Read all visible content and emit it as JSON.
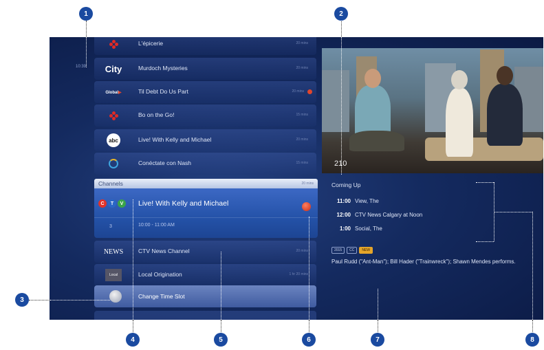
{
  "clock": "10:39",
  "guide": {
    "rows": [
      {
        "logo": "cbc",
        "title": "L'épicerie",
        "duration": "20 mins"
      },
      {
        "logo": "city",
        "logo_text": "City",
        "title": "Murdoch Mysteries",
        "duration": "20 mins"
      },
      {
        "logo": "global",
        "logo_text": "Global",
        "title": "Til Debt Do Us Part",
        "duration": "20 mins"
      },
      {
        "logo": "cbc",
        "title": "Bo on the Go!",
        "duration": "15 mins"
      },
      {
        "logo": "abc",
        "logo_text": "abc",
        "title": "Live! With Kelly and Michael",
        "duration": "20 mins"
      },
      {
        "logo": "omni",
        "title": "Conéctate con Nash",
        "duration": "15 mins"
      }
    ],
    "channels_label": "Channels",
    "channels_duration": "20 mins",
    "selected": {
      "logo_letters": [
        "C",
        "T",
        "V"
      ],
      "channel_number": "3",
      "title": "Live! With Kelly and Michael",
      "time": "10:00 - 11:00 AM"
    },
    "rows_below": [
      {
        "logo_text": "NEWS",
        "title": "CTV News Channel",
        "duration": "20 mins"
      },
      {
        "logo_text": "Local",
        "title": "Local Origination",
        "duration": "1 hr 20 mins"
      }
    ],
    "change_time_slot": "Change Time Slot"
  },
  "preview": {
    "channel_number": "210"
  },
  "coming_up": {
    "header": "Coming Up",
    "items": [
      {
        "time": "11:00",
        "title": "View, The"
      },
      {
        "time": "12:00",
        "title": "CTV News Calgary at Noon"
      },
      {
        "time": "1:00",
        "title": "Social, The"
      }
    ]
  },
  "details": {
    "badges": [
      "2015",
      "CC",
      "NEW"
    ],
    "description": "Paul Rudd (\"Ant-Man\"); Bill Hader (\"Trainwreck\"); Shawn Mendes performs."
  },
  "callouts": [
    "1",
    "2",
    "3",
    "4",
    "5",
    "6",
    "7",
    "8"
  ],
  "colors": {
    "screen_bg": "#142a5f",
    "selected_row": "#2452a8",
    "record_dot": "#e0462d",
    "callout_badge": "#1a4aa0"
  }
}
